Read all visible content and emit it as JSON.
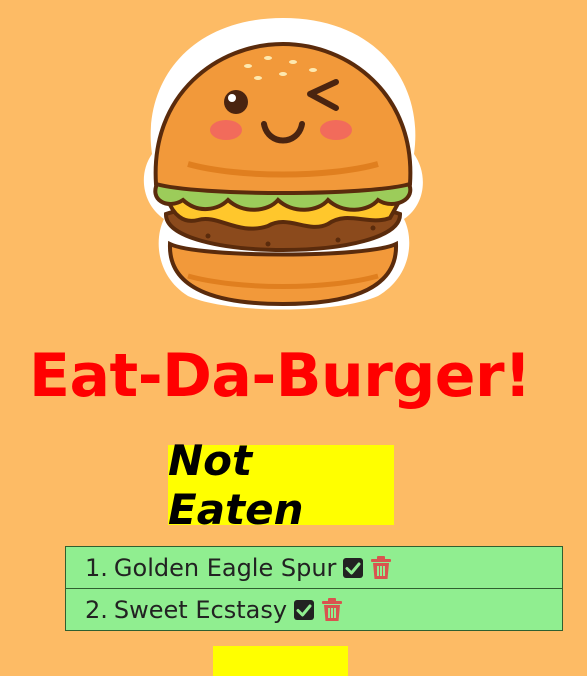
{
  "header": {
    "title": "Eat-Da-Burger!"
  },
  "sections": {
    "not_eaten_heading": "Not Eaten"
  },
  "burgers_not_eaten": [
    {
      "number": "1.",
      "name": "Golden Eagle Spur",
      "devour_icon": "check-square-icon",
      "delete_icon": "trash-icon"
    },
    {
      "number": "2.",
      "name": "Sweet Ecstasy",
      "devour_icon": "check-square-icon",
      "delete_icon": "trash-icon"
    }
  ],
  "colors": {
    "background": "#fdbb65",
    "title": "#ff0000",
    "heading_bg": "#ffff00",
    "list_bg": "#90ee90",
    "delete_icon": "#d9534f"
  }
}
